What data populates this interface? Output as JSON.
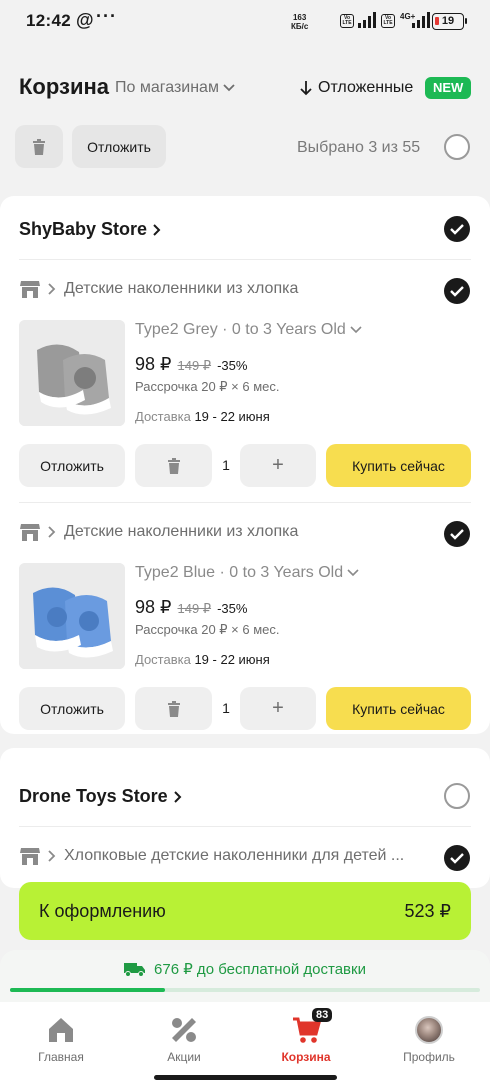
{
  "status_bar": {
    "time": "12:42",
    "at": "@",
    "dots": "···",
    "speed_value": "163",
    "speed_unit": "КБ/с",
    "volte": "Vo LTE",
    "network": "4G+",
    "battery": "19"
  },
  "header": {
    "title": "Корзина",
    "sort_label": "По магазинам",
    "saved_label": "Отложенные",
    "new_badge": "NEW",
    "defer_all_label": "Отложить",
    "selected_text": "Выбрано 3 из 55"
  },
  "stores": [
    {
      "name": "ShyBaby Store",
      "checked": true,
      "products": [
        {
          "title": "Детские наколенники из хлопка",
          "variant": "Type2 Grey · 0 to 3 Years Old",
          "price": "98 ₽",
          "old_price": "149 ₽",
          "discount": "-35%",
          "installment": "Рассрочка 20 ₽ × 6 мес.",
          "delivery_label": "Доставка",
          "delivery_dates": "19 - 22 июня",
          "defer_label": "Отложить",
          "quantity": "1",
          "plus": "+",
          "buy_label": "Купить сейчас",
          "color": "#9a9a9a"
        },
        {
          "title": "Детские наколенники из хлопка",
          "variant": "Type2 Blue · 0 to 3 Years Old",
          "price": "98 ₽",
          "old_price": "149 ₽",
          "discount": "-35%",
          "installment": "Рассрочка 20 ₽ × 6 мес.",
          "delivery_label": "Доставка",
          "delivery_dates": "19 - 22 июня",
          "defer_label": "Отложить",
          "quantity": "1",
          "plus": "+",
          "buy_label": "Купить сейчас",
          "color": "#5b8fd6"
        }
      ]
    },
    {
      "name": "Drone Toys Store",
      "checked": false,
      "products": [
        {
          "title": "Хлопковые детские наколенники для детей ..."
        }
      ]
    }
  ],
  "checkout": {
    "label": "К оформлению",
    "total": "523 ₽"
  },
  "free_delivery": {
    "text": "676 ₽ до бесплатной доставки",
    "progress": 0.33
  },
  "nav": {
    "home": "Главная",
    "promo": "Акции",
    "cart": "Корзина",
    "cart_count": "83",
    "profile": "Профиль"
  },
  "colors": {
    "accent_green": "#1db954",
    "checkout_green": "#b8f135",
    "buy_yellow": "#f7dd4f",
    "active_red": "#e0352b"
  },
  "icons": [
    "trash-icon",
    "arrow-down-icon",
    "chevron-down-icon",
    "chevron-right-icon",
    "store-icon",
    "check-icon",
    "truck-icon",
    "home-icon",
    "percent-icon",
    "cart-icon"
  ]
}
